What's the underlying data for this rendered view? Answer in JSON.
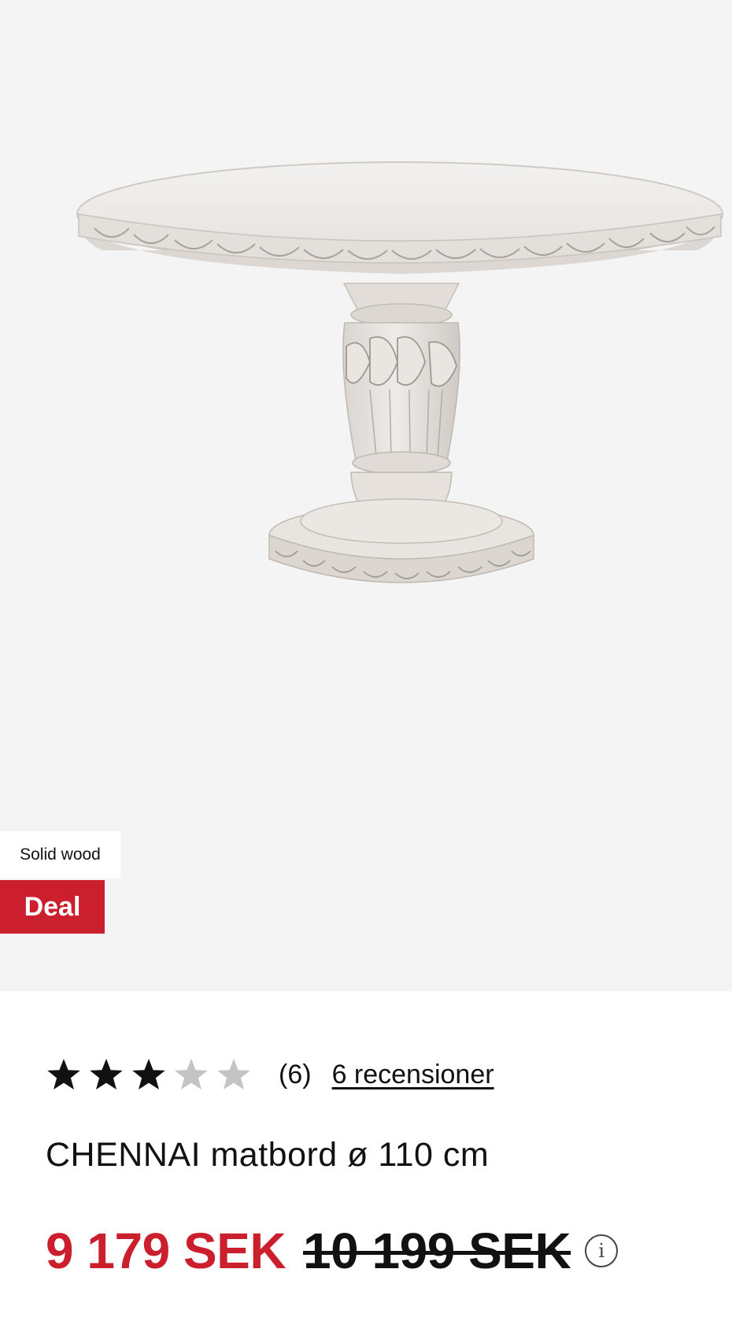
{
  "product": {
    "image_alt": "CHENNAI matbord",
    "badges": {
      "material": "Solid wood",
      "deal": "Deal"
    },
    "rating": {
      "value": 3,
      "max": 5,
      "count_text": "(6)",
      "reviews_link": "6 recensioner"
    },
    "title": "CHENNAI matbord ø 110 cm",
    "price": {
      "current": "9 179 SEK",
      "original": "10 199 SEK"
    }
  },
  "icons": {
    "star_filled": "star-filled-icon",
    "star_empty": "star-empty-icon",
    "info": "info-icon"
  },
  "colors": {
    "deal_red": "#cc1f2e",
    "image_bg": "#f4f4f4",
    "star_filled": "#111111",
    "star_empty": "#c4c4c4"
  }
}
